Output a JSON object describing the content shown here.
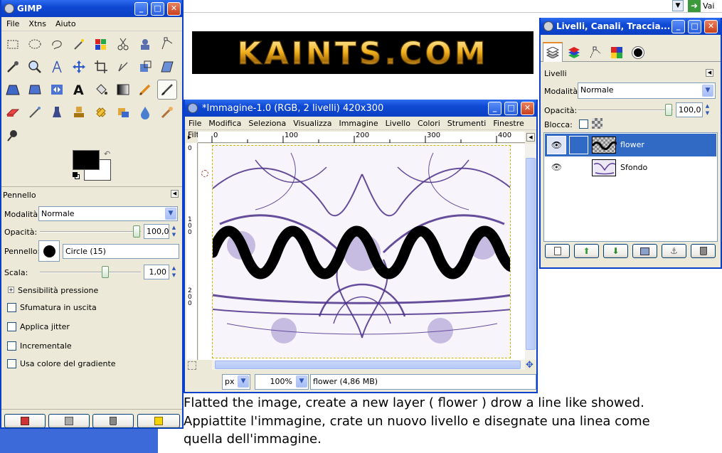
{
  "browser": {
    "go_label": "Vai"
  },
  "logo_text": "KAINTS.COM",
  "toolbox": {
    "title": "GIMP",
    "menu": [
      "File",
      "Xtns",
      "Aiuto"
    ],
    "options_title": "Pennello",
    "mode_label": "Modalità:",
    "mode_value": "Normale",
    "opacity_label": "Opacità:",
    "opacity_value": "100,0",
    "opacity_fraction": 1.0,
    "brush_label": "Pennello:",
    "brush_value": "Circle (15)",
    "scale_label": "Scala:",
    "scale_value": "1,00",
    "pressure_label": "Sensibilità pressione",
    "checkboxes": [
      "Sfumatura in uscita",
      "Applica jitter",
      "Incrementale",
      "Usa colore del gradiente"
    ],
    "fg_color": "#000000",
    "bg_color": "#ffffff"
  },
  "image_window": {
    "title": "*Immagine-1.0 (RGB, 2 livelli) 420x300",
    "menu": [
      "File",
      "Modifica",
      "Seleziona",
      "Visualizza",
      "Immagine",
      "Livello",
      "Colori",
      "Strumenti",
      "Finestre",
      "Filtri"
    ],
    "ruler_ticks": [
      "0",
      "100",
      "200",
      "300",
      "400"
    ],
    "vruler_ticks": [
      "0",
      "100",
      "200"
    ],
    "unit": "px",
    "zoom": "100%",
    "status": "flower (4,86 MB)"
  },
  "layers": {
    "title": "Livelli, Canali, Traccia...",
    "section": "Livelli",
    "mode_label": "Modalità:",
    "mode_value": "Normale",
    "opacity_label": "Opacità:",
    "opacity_value": "100,0",
    "lock_label": "Blocca:",
    "items": [
      {
        "name": "flower",
        "selected": true
      },
      {
        "name": "Sfondo",
        "selected": false
      }
    ]
  },
  "instructions": {
    "line1": "Flatted the image, create a new layer ( flower ) drow a line like showed.",
    "line2": "Appiattite l'immagine, crate un nuovo livello e disegnate una linea come",
    "line3": "quella dell'immagine."
  }
}
